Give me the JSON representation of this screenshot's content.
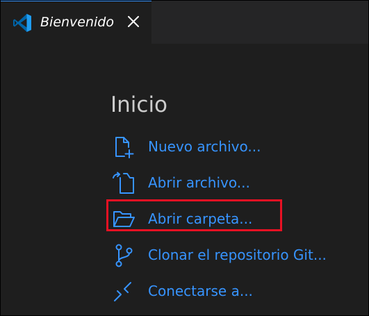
{
  "tab": {
    "title": "Bienvenido",
    "icon": "vscode-logo-icon"
  },
  "start": {
    "heading": "Inicio",
    "items": [
      {
        "label": "Nuevo archivo...",
        "icon": "new-file-icon"
      },
      {
        "label": "Abrir archivo...",
        "icon": "open-file-icon"
      },
      {
        "label": "Abrir carpeta...",
        "icon": "open-folder-icon",
        "highlighted": true
      },
      {
        "label": "Clonar el repositorio Git...",
        "icon": "git-branch-icon"
      },
      {
        "label": "Conectarse a...",
        "icon": "remote-connect-icon"
      }
    ]
  },
  "colors": {
    "background": "#1e1e1e",
    "tabbar": "#252526",
    "link": "#3794ff",
    "heading": "#cccccc",
    "highlight": "#e81123"
  }
}
